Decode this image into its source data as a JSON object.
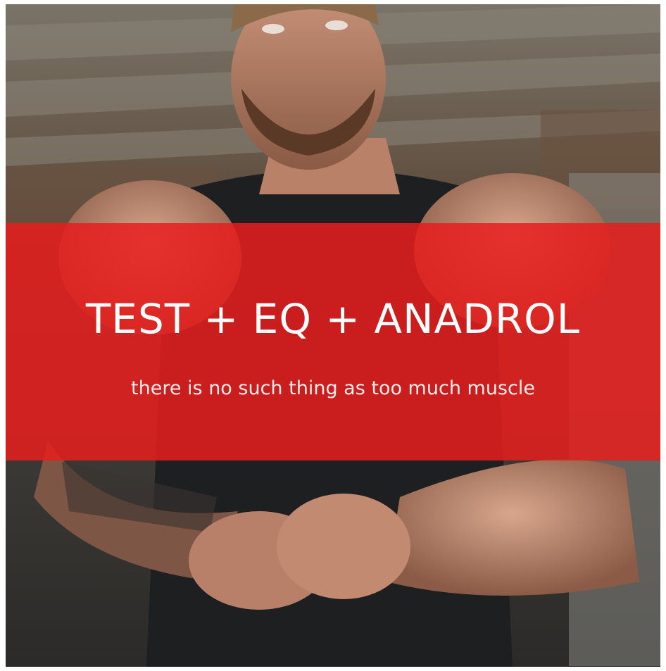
{
  "banner": {
    "headline": "TEST + EQ + ANADROL",
    "tagline": "there is no such thing as too much muscle",
    "color": "#e71e1e"
  },
  "photo": {
    "subject": "bodybuilder-in-gym"
  }
}
